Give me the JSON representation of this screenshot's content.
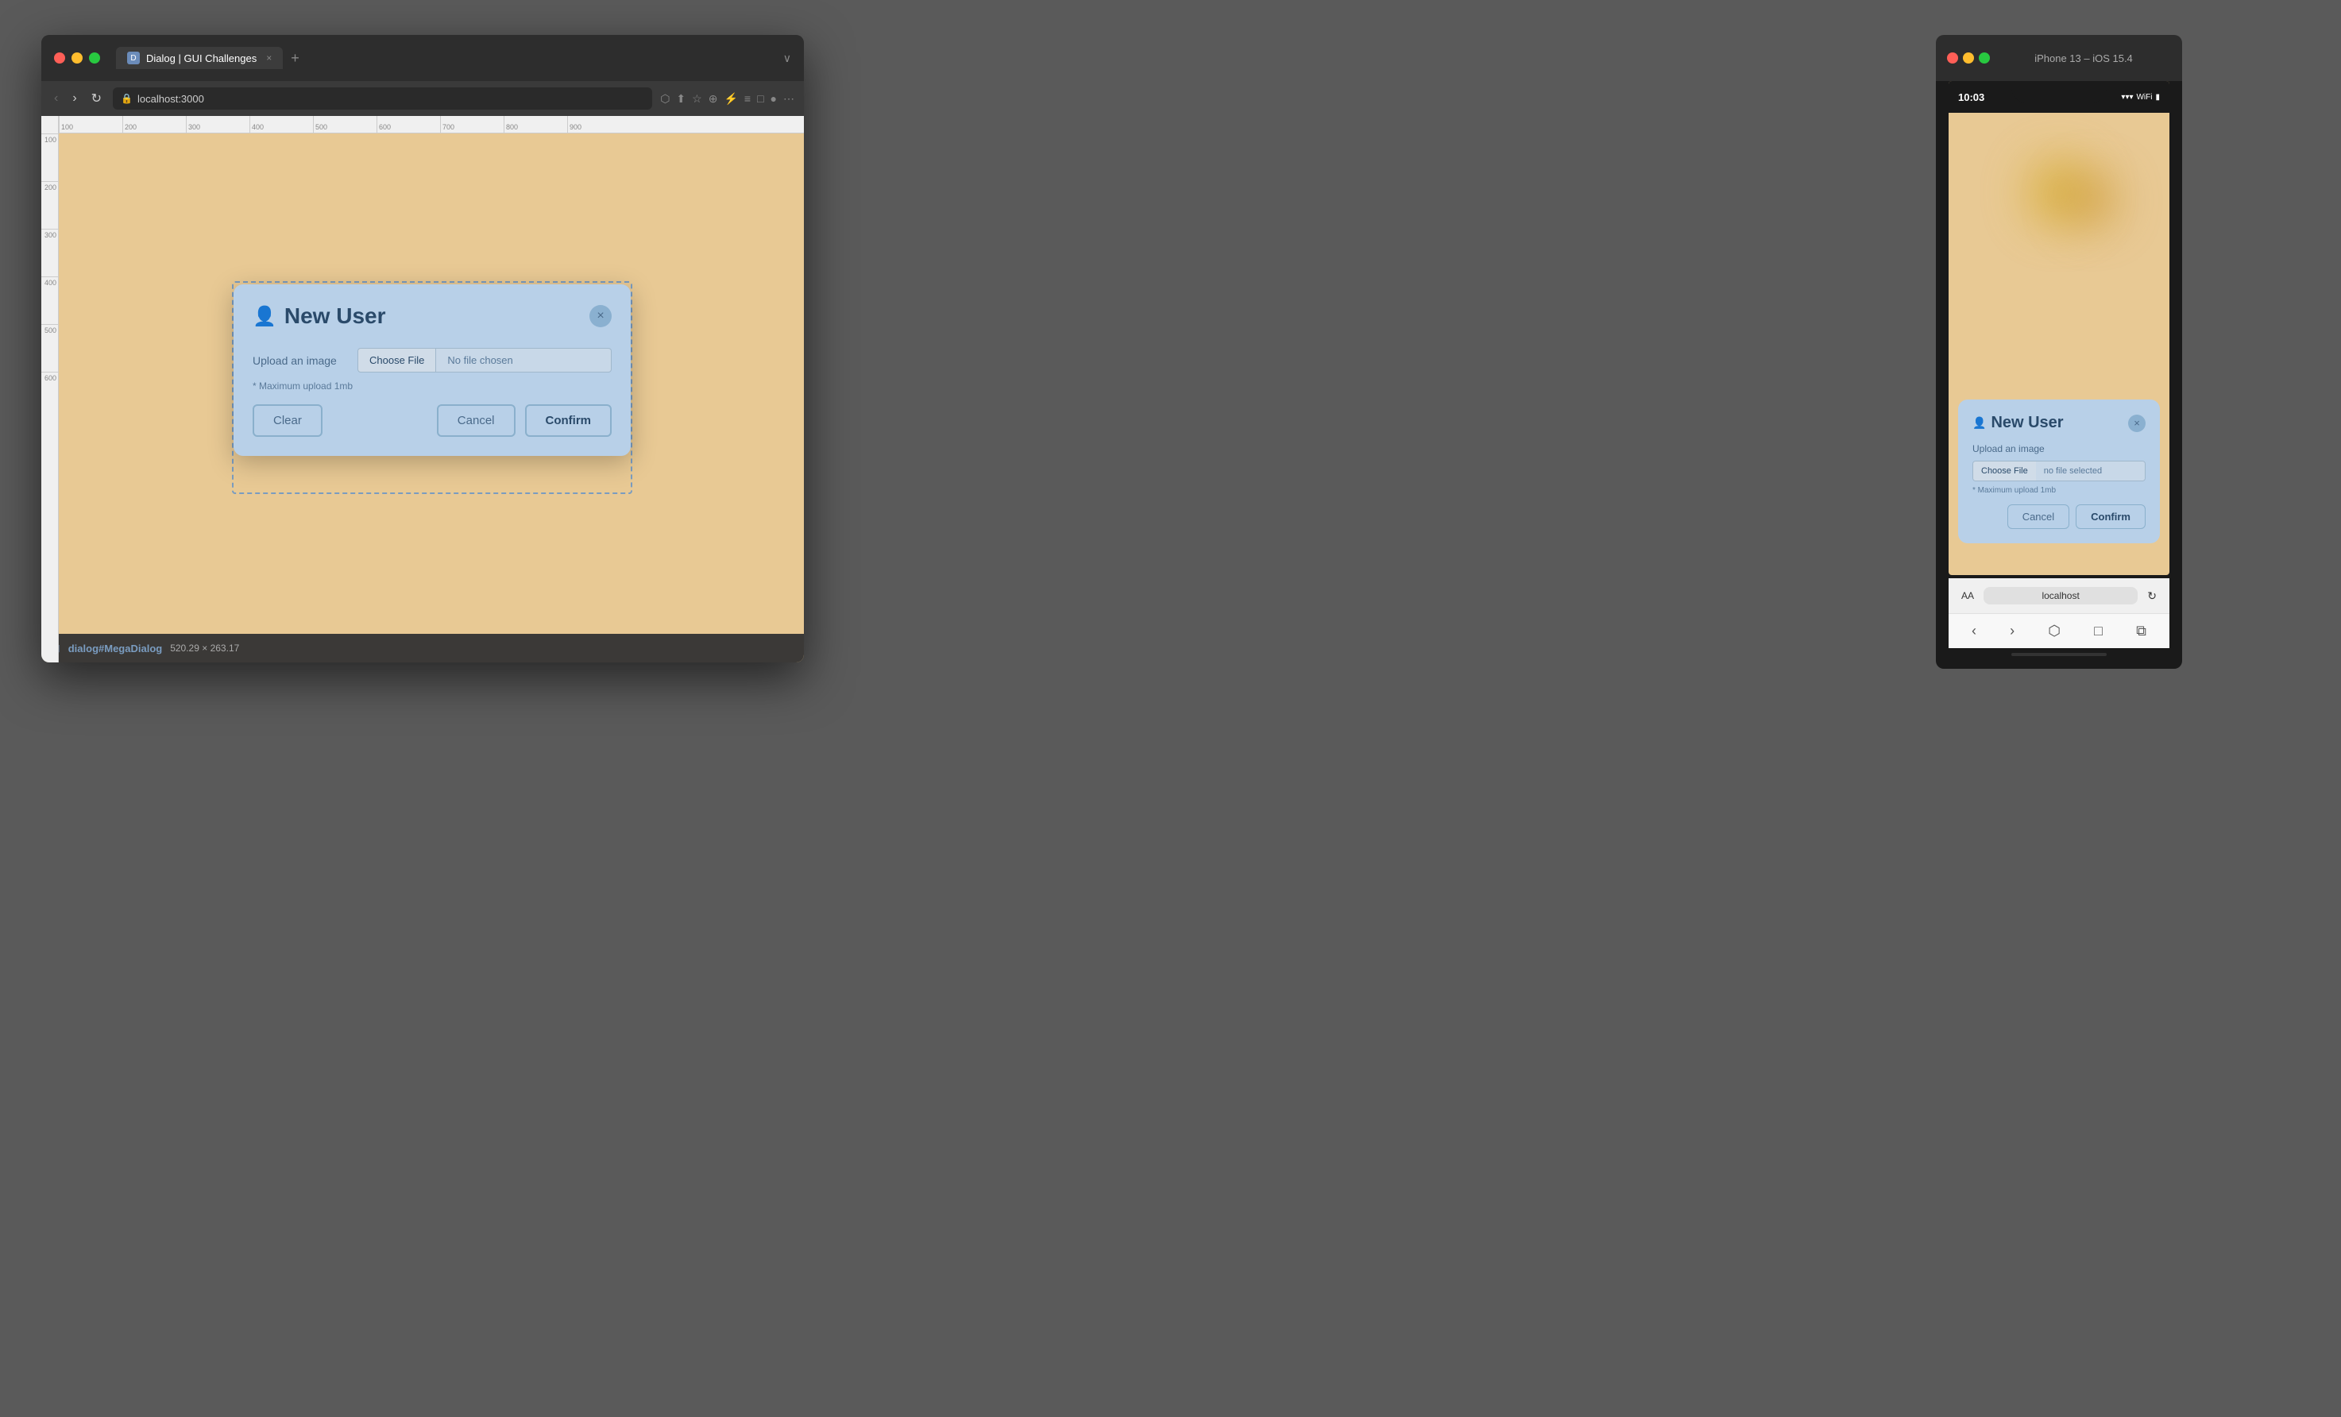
{
  "browser": {
    "tab_title": "Dialog | GUI Challenges",
    "tab_favicon_label": "D",
    "url": "localhost:3000",
    "tab_close": "×",
    "tab_new": "+",
    "expand_icon": "∨"
  },
  "nav": {
    "back": "‹",
    "forward": "›",
    "reload": "↻",
    "share": "⬡",
    "star": "☆",
    "shield": "⊕",
    "plugin": "⚡",
    "reader": "≡",
    "phone": "□",
    "mic": "●",
    "more": "⋯"
  },
  "desktop_dialog": {
    "title": "New User",
    "user_icon": "👤+",
    "close": "×",
    "upload_label": "Upload an image",
    "choose_file_btn": "Choose File",
    "no_file_chosen": "No file chosen",
    "max_upload_text": "* Maximum upload 1mb",
    "btn_clear": "Clear",
    "btn_cancel": "Cancel",
    "btn_confirm": "Confirm"
  },
  "phone": {
    "window_title": "iPhone 13 – iOS 15.4",
    "time": "10:03",
    "status_wifi": "▾▾▾",
    "status_signal": "•••",
    "status_battery": "▮",
    "dialog": {
      "title": "New User",
      "upload_label": "Upload an image",
      "choose_file_btn": "Choose File",
      "no_file_text": "no file selected",
      "max_upload_text": "* Maximum upload 1mb",
      "btn_cancel": "Cancel",
      "btn_confirm": "Confirm"
    },
    "toolbar": {
      "aa": "AA",
      "address": "localhost",
      "reload": "↻"
    },
    "nav_back": "‹",
    "nav_forward": "›",
    "nav_share": "⬡",
    "nav_bookmarks": "□",
    "nav_tabs": "⧉"
  },
  "bottom_bar": {
    "selector_label": "dialog#MegaDialog",
    "dimensions": "520.29 × 263.17"
  },
  "ruler": {
    "top_ticks": [
      "100",
      "200",
      "300",
      "400",
      "500",
      "600",
      "700",
      "800",
      "900"
    ],
    "left_ticks": [
      "100",
      "200",
      "300",
      "400",
      "500",
      "600"
    ]
  }
}
